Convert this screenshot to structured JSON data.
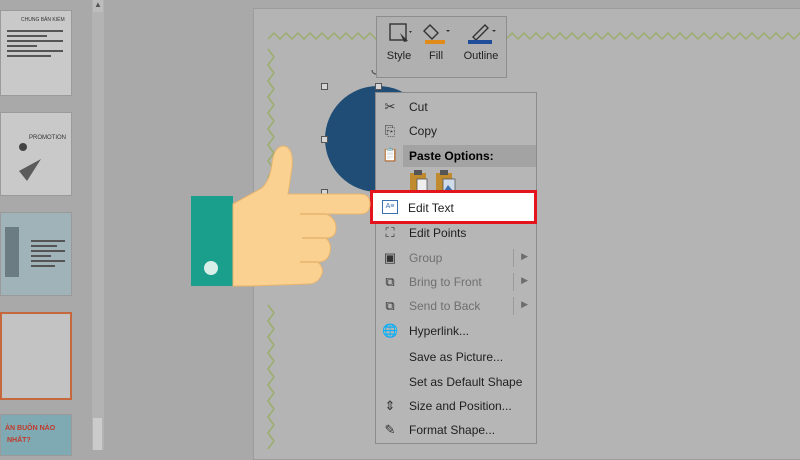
{
  "mini_toolbar": {
    "style_label": "Style",
    "fill_label": "Fill",
    "outline_label": "Outline"
  },
  "context_menu": {
    "items": [
      {
        "label": "Cut",
        "icon": "scissors-icon",
        "enabled": true
      },
      {
        "label": "Copy",
        "icon": "copy-icon",
        "enabled": true
      },
      {
        "label": "Edit Points",
        "icon": "edit-points-icon",
        "enabled": true
      },
      {
        "label": "Group",
        "icon": "group-icon",
        "enabled": false
      },
      {
        "label": "Bring to Front",
        "icon": "bring-front-icon",
        "enabled": false
      },
      {
        "label": "Send to Back",
        "icon": "send-back-icon",
        "enabled": false
      },
      {
        "label": "Hyperlink...",
        "icon": "hyperlink-icon",
        "enabled": true
      },
      {
        "label": "Save as Picture...",
        "icon": "",
        "enabled": true
      },
      {
        "label": "Set as Default Shape",
        "icon": "",
        "enabled": true
      },
      {
        "label": "Size and Position...",
        "icon": "size-position-icon",
        "enabled": true
      },
      {
        "label": "Format Shape...",
        "icon": "format-shape-icon",
        "enabled": true
      }
    ],
    "paste_options_label": "Paste Options:",
    "highlighted_item": "Edit Text"
  },
  "thumbnails": {
    "slide1_title": "CHUNG BẢN KIỂM",
    "slide2_title": "PROMOTION",
    "slide5_text1": "ẢN BUÔN NÀO",
    "slide5_text2": "NHẤT?"
  },
  "colors": {
    "highlight_border": "#e3141b",
    "shape_fill": "#1f4d75",
    "hand_cuff": "#1a9f8d",
    "hand_skin": "#fbd192"
  }
}
